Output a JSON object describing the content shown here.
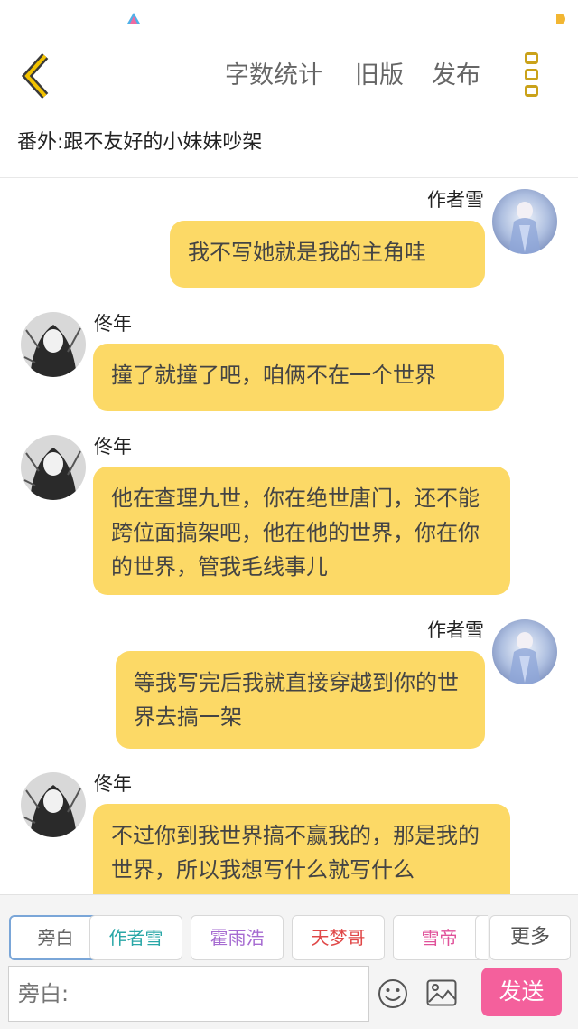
{
  "nav": {
    "word_count": "字数统计",
    "old_version": "旧版",
    "publish": "发布"
  },
  "story": {
    "title": "番外:跟不友好的小妹妹吵架"
  },
  "messages": [
    {
      "speaker": "作者雪",
      "side": "right",
      "text": "我不写她就是我的主角哇"
    },
    {
      "speaker": "佟年",
      "side": "left",
      "text": "撞了就撞了吧，咱俩不在一个世界"
    },
    {
      "speaker": "佟年",
      "side": "left",
      "text": "他在查理九世，你在绝世唐门，还不能跨位面搞架吧，他在他的世界，你在你的世界，管我毛线事儿"
    },
    {
      "speaker": "作者雪",
      "side": "right",
      "text": "等我写完后我就直接穿越到你的世界去搞一架"
    },
    {
      "speaker": "佟年",
      "side": "left",
      "text": "不过你到我世界搞不赢我的，那是我的世界，所以我想写什么就写什么"
    }
  ],
  "roles": [
    {
      "label": "旁白",
      "color": "#666666",
      "active": true
    },
    {
      "label": "作者雪",
      "color": "#2aa7a7",
      "active": false
    },
    {
      "label": "霍雨浩",
      "color": "#a66bd1",
      "active": false
    },
    {
      "label": "天梦哥",
      "color": "#e04848",
      "active": false
    },
    {
      "label": "雪帝",
      "color": "#e0529a",
      "active": false
    }
  ],
  "more_roles": "更多",
  "input": {
    "placeholder": "旁白:"
  },
  "send_label": "发送",
  "colors": {
    "bubble": "#fcd966",
    "send": "#f4609c",
    "accent": "#caa21a"
  }
}
